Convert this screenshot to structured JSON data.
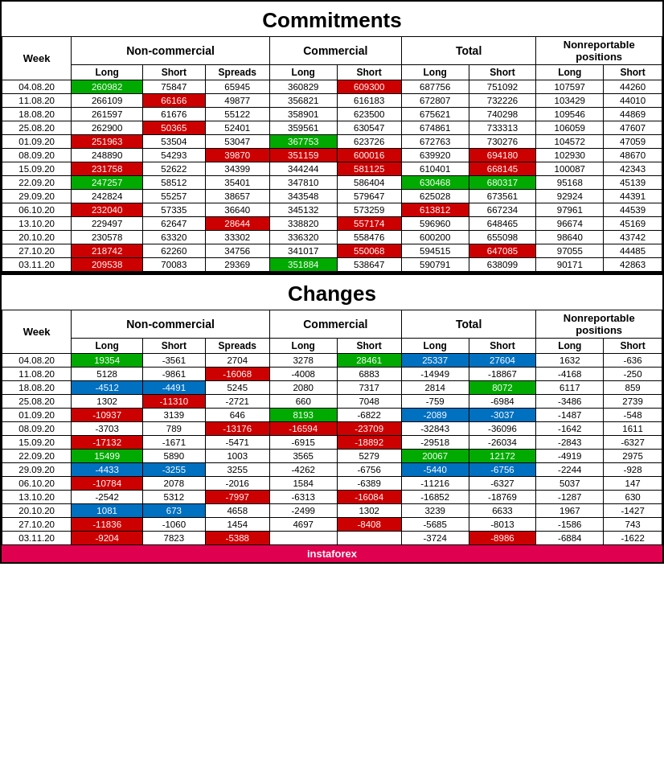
{
  "commitments_title": "Commitments",
  "changes_title": "Changes",
  "headers": {
    "week": "Week",
    "non_commercial": "Non-commercial",
    "commercial": "Commercial",
    "total": "Total",
    "nonreportable": "Nonreportable\npositions",
    "long": "Long",
    "short": "Short",
    "spreads": "Spreads"
  },
  "commitments_rows": [
    {
      "week": "04.08.20",
      "nc_long": "260982",
      "nc_long_bg": "bg-green",
      "nc_short": "75847",
      "nc_spreads": "65945",
      "comm_long": "360829",
      "comm_short": "609300",
      "comm_short_bg": "bg-red",
      "total_long": "687756",
      "total_short": "751092",
      "nr_long": "107597",
      "nr_short": "44260"
    },
    {
      "week": "11.08.20",
      "nc_long": "266109",
      "nc_short": "66166",
      "nc_short_bg": "bg-red",
      "nc_spreads": "49877",
      "comm_long": "356821",
      "comm_short": "616183",
      "total_long": "672807",
      "total_short": "732226",
      "nr_long": "103429",
      "nr_short": "44010"
    },
    {
      "week": "18.08.20",
      "nc_long": "261597",
      "nc_short": "61676",
      "nc_spreads": "55122",
      "comm_long": "358901",
      "comm_short": "623500",
      "total_long": "675621",
      "total_short": "740298",
      "nr_long": "109546",
      "nr_short": "44869"
    },
    {
      "week": "25.08.20",
      "nc_long": "262900",
      "nc_short": "50365",
      "nc_short_bg": "bg-red",
      "nc_spreads": "52401",
      "comm_long": "359561",
      "comm_short": "630547",
      "total_long": "674861",
      "total_short": "733313",
      "nr_long": "106059",
      "nr_short": "47607"
    },
    {
      "week": "01.09.20",
      "nc_long": "251963",
      "nc_long_bg": "bg-red",
      "nc_short": "53504",
      "nc_spreads": "53047",
      "comm_long": "367753",
      "comm_long_bg": "bg-green",
      "comm_short": "623726",
      "total_long": "672763",
      "total_short": "730276",
      "nr_long": "104572",
      "nr_short": "47059"
    },
    {
      "week": "08.09.20",
      "nc_long": "248890",
      "nc_short": "54293",
      "nc_spreads": "39870",
      "nc_spreads_bg": "bg-red",
      "comm_long": "351159",
      "comm_long_bg": "bg-red",
      "comm_short": "600016",
      "comm_short_bg": "bg-red",
      "total_long": "639920",
      "total_short": "694180",
      "total_short_bg": "bg-red",
      "nr_long": "102930",
      "nr_short": "48670"
    },
    {
      "week": "15.09.20",
      "nc_long": "231758",
      "nc_long_bg": "bg-red",
      "nc_short": "52622",
      "nc_spreads": "34399",
      "comm_long": "344244",
      "comm_short": "581125",
      "comm_short_bg": "bg-red",
      "total_long": "610401",
      "total_short": "668145",
      "total_short_bg": "bg-red",
      "nr_long": "100087",
      "nr_short": "42343"
    },
    {
      "week": "22.09.20",
      "nc_long": "247257",
      "nc_long_bg": "bg-green",
      "nc_short": "58512",
      "nc_spreads": "35401",
      "comm_long": "347810",
      "comm_short": "586404",
      "total_long": "630468",
      "total_long_bg": "bg-green",
      "total_short": "680317",
      "total_short_bg": "bg-green",
      "nr_long": "95168",
      "nr_short": "45139"
    },
    {
      "week": "29.09.20",
      "nc_long": "242824",
      "nc_short": "55257",
      "nc_spreads": "38657",
      "comm_long": "343548",
      "comm_short": "579647",
      "total_long": "625028",
      "total_short": "673561",
      "nr_long": "92924",
      "nr_short": "44391"
    },
    {
      "week": "06.10.20",
      "nc_long": "232040",
      "nc_long_bg": "bg-red",
      "nc_short": "57335",
      "nc_spreads": "36640",
      "comm_long": "345132",
      "comm_short": "573259",
      "total_long": "613812",
      "total_long_bg": "bg-red",
      "total_short": "667234",
      "nr_long": "97961",
      "nr_short": "44539"
    },
    {
      "week": "13.10.20",
      "nc_long": "229497",
      "nc_short": "62647",
      "nc_spreads": "28644",
      "nc_spreads_bg": "bg-red",
      "comm_long": "338820",
      "comm_short": "557174",
      "comm_short_bg": "bg-red",
      "total_long": "596960",
      "total_short": "648465",
      "nr_long": "96674",
      "nr_short": "45169"
    },
    {
      "week": "20.10.20",
      "nc_long": "230578",
      "nc_short": "63320",
      "nc_spreads": "33302",
      "comm_long": "336320",
      "comm_short": "558476",
      "total_long": "600200",
      "total_short": "655098",
      "nr_long": "98640",
      "nr_short": "43742"
    },
    {
      "week": "27.10.20",
      "nc_long": "218742",
      "nc_long_bg": "bg-red",
      "nc_short": "62260",
      "nc_spreads": "34756",
      "comm_long": "341017",
      "comm_short": "550068",
      "comm_short_bg": "bg-red",
      "total_long": "594515",
      "total_short": "647085",
      "total_short_bg": "bg-red",
      "nr_long": "97055",
      "nr_short": "44485"
    },
    {
      "week": "03.11.20",
      "nc_long": "209538",
      "nc_long_bg": "bg-red",
      "nc_short": "70083",
      "nc_spreads": "29369",
      "comm_long": "351884",
      "comm_long_bg": "bg-green",
      "comm_short": "538647",
      "total_long": "590791",
      "total_long_bg": "",
      "total_short": "638099",
      "nr_long": "90171",
      "nr_short": "42863"
    }
  ],
  "changes_rows": [
    {
      "week": "04.08.20",
      "nc_long": "19354",
      "nc_long_bg": "bg-green",
      "nc_short": "-3561",
      "nc_spreads": "2704",
      "comm_long": "3278",
      "comm_short": "28461",
      "comm_short_bg": "bg-green",
      "total_long": "25337",
      "total_long_bg": "bg-blue",
      "total_short": "27604",
      "total_short_bg": "bg-blue",
      "nr_long": "1632",
      "nr_short": "-636"
    },
    {
      "week": "11.08.20",
      "nc_long": "5128",
      "nc_short": "-9861",
      "nc_spreads": "-16068",
      "nc_spreads_bg": "bg-red",
      "comm_long": "-4008",
      "comm_short": "6883",
      "total_long": "-14949",
      "total_short": "-18867",
      "nr_long": "-4168",
      "nr_short": "-250"
    },
    {
      "week": "18.08.20",
      "nc_long": "-4512",
      "nc_long_bg": "bg-blue",
      "nc_short": "-4491",
      "nc_short_bg": "bg-blue",
      "nc_spreads": "5245",
      "comm_long": "2080",
      "comm_short": "7317",
      "total_long": "2814",
      "total_short": "8072",
      "total_short_bg": "bg-green",
      "nr_long": "6117",
      "nr_short": "859"
    },
    {
      "week": "25.08.20",
      "nc_long": "1302",
      "nc_short": "-11310",
      "nc_short_bg": "bg-red",
      "nc_spreads": "-2721",
      "comm_long": "660",
      "comm_short": "7048",
      "total_long": "-759",
      "total_short": "-6984",
      "nr_long": "-3486",
      "nr_short": "2739"
    },
    {
      "week": "01.09.20",
      "nc_long": "-10937",
      "nc_long_bg": "bg-red",
      "nc_short": "3139",
      "nc_spreads": "646",
      "comm_long": "8193",
      "comm_long_bg": "bg-green",
      "comm_short": "-6822",
      "total_long": "-2089",
      "total_long_bg": "bg-blue",
      "total_short": "-3037",
      "total_short_bg": "bg-blue",
      "nr_long": "-1487",
      "nr_short": "-548"
    },
    {
      "week": "08.09.20",
      "nc_long": "-3703",
      "nc_short": "789",
      "nc_spreads": "-13176",
      "nc_spreads_bg": "bg-red",
      "comm_long": "-16594",
      "comm_long_bg": "bg-red",
      "comm_short": "-23709",
      "comm_short_bg": "bg-red",
      "total_long": "-32843",
      "total_short": "-36096",
      "nr_long": "-1642",
      "nr_short": "1611"
    },
    {
      "week": "15.09.20",
      "nc_long": "-17132",
      "nc_long_bg": "bg-red",
      "nc_short": "-1671",
      "nc_spreads": "-5471",
      "comm_long": "-6915",
      "comm_short": "-18892",
      "comm_short_bg": "bg-red",
      "total_long": "-29518",
      "total_short": "-26034",
      "nr_long": "-2843",
      "nr_short": "-6327"
    },
    {
      "week": "22.09.20",
      "nc_long": "15499",
      "nc_long_bg": "bg-green",
      "nc_short": "5890",
      "nc_spreads": "1003",
      "comm_long": "3565",
      "comm_short": "5279",
      "total_long": "20067",
      "total_long_bg": "bg-green",
      "total_short": "12172",
      "total_short_bg": "bg-green",
      "nr_long": "-4919",
      "nr_short": "2975"
    },
    {
      "week": "29.09.20",
      "nc_long": "-4433",
      "nc_long_bg": "bg-blue",
      "nc_short": "-3255",
      "nc_short_bg": "bg-blue",
      "nc_spreads": "3255",
      "comm_long": "-4262",
      "comm_short": "-6756",
      "total_long": "-5440",
      "total_long_bg": "bg-blue",
      "total_short": "-6756",
      "total_short_bg": "bg-blue",
      "nr_long": "-2244",
      "nr_short": "-928"
    },
    {
      "week": "06.10.20",
      "nc_long": "-10784",
      "nc_long_bg": "bg-red",
      "nc_short": "2078",
      "nc_spreads": "-2016",
      "comm_long": "1584",
      "comm_short": "-6389",
      "total_long": "-11216",
      "total_short": "-6327",
      "nr_long": "5037",
      "nr_short": "147"
    },
    {
      "week": "13.10.20",
      "nc_long": "-2542",
      "nc_short": "5312",
      "nc_spreads": "-7997",
      "nc_spreads_bg": "bg-red",
      "comm_long": "-6313",
      "comm_short": "-16084",
      "comm_short_bg": "bg-red",
      "total_long": "-16852",
      "total_short": "-18769",
      "nr_long": "-1287",
      "nr_short": "630"
    },
    {
      "week": "20.10.20",
      "nc_long": "1081",
      "nc_long_bg": "bg-blue",
      "nc_short": "673",
      "nc_short_bg": "bg-blue",
      "nc_spreads": "4658",
      "comm_long": "-2499",
      "comm_short": "1302",
      "total_long": "3239",
      "total_short": "6633",
      "nr_long": "1967",
      "nr_short": "-1427"
    },
    {
      "week": "27.10.20",
      "nc_long": "-11836",
      "nc_long_bg": "bg-red",
      "nc_short": "-1060",
      "nc_spreads": "1454",
      "comm_long": "4697",
      "comm_short": "-8408",
      "comm_short_bg": "bg-red",
      "total_long": "-5685",
      "total_short": "-8013",
      "nr_long": "-1586",
      "nr_short": "743"
    },
    {
      "week": "03.11.20",
      "nc_long": "-9204",
      "nc_long_bg": "bg-red",
      "nc_short": "7823",
      "nc_spreads": "-5388",
      "nc_spreads_bg": "bg-red",
      "comm_long": "",
      "comm_short": "",
      "total_long": "-3724",
      "total_short": "-8986",
      "total_short_bg": "bg-red",
      "nr_long": "-6884",
      "nr_short": "-1622"
    }
  ]
}
